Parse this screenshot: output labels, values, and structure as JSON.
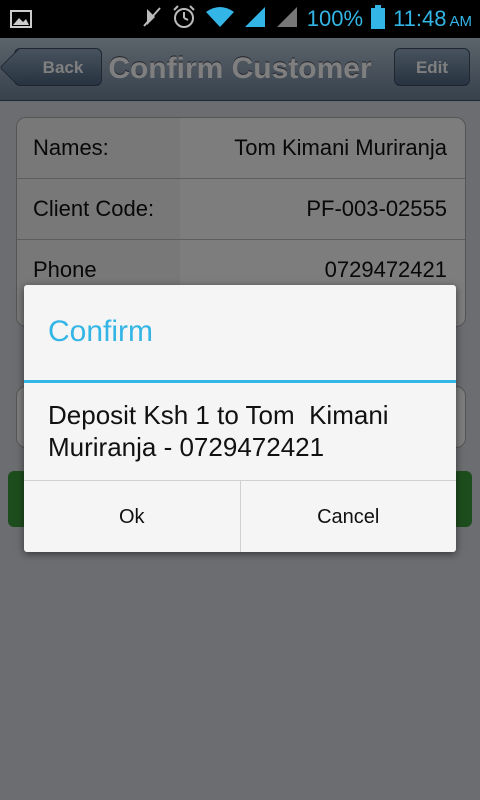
{
  "status_bar": {
    "battery": "100%",
    "time": "11:48",
    "ampm": "AM",
    "icons": [
      "image-icon",
      "mute-icon",
      "alarm-icon",
      "wifi-icon",
      "signal-icon",
      "signal-icon-2",
      "battery-icon"
    ]
  },
  "header": {
    "back_label": "Back",
    "title": "Confirm Customer",
    "edit_label": "Edit"
  },
  "customer": {
    "rows": [
      {
        "label": "Names:",
        "value": "Tom Kimani Muriranja"
      },
      {
        "label": "Client Code:",
        "value": "PF-003-02555"
      },
      {
        "label": "Phone",
        "value": "0729472421"
      }
    ]
  },
  "dialog": {
    "title": "Confirm",
    "message": "Deposit Ksh 1 to Tom  Kimani Muriranja - 0729472421",
    "ok_label": "Ok",
    "cancel_label": "Cancel"
  },
  "colors": {
    "accent": "#33b5e5",
    "header_top": "#b8c7d6",
    "header_bottom": "#6e8399"
  }
}
